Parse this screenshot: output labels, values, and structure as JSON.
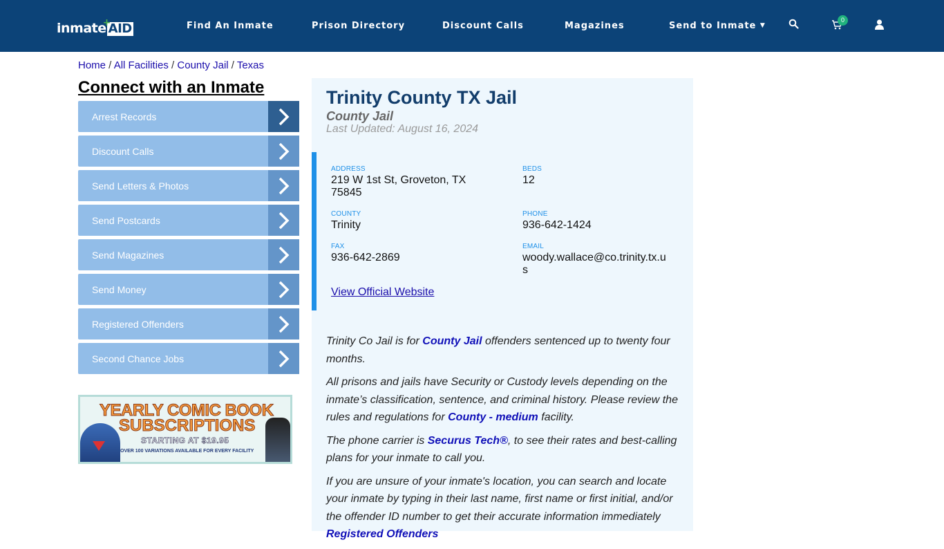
{
  "header": {
    "logo": {
      "text": "inmate",
      "accent": "AID"
    },
    "nav": [
      {
        "label": "Find An Inmate"
      },
      {
        "label": "Prison Directory"
      },
      {
        "label": "Discount Calls"
      },
      {
        "label": "Magazines"
      },
      {
        "label": "Send to Inmate",
        "has_dropdown": true
      }
    ],
    "icons": {
      "search": "search-icon",
      "cart": "cart-icon",
      "user": "user-icon"
    },
    "cart_count": "0",
    "colors": {
      "nav_bg": "#0c4378",
      "badge": "#20b27d"
    }
  },
  "breadcrumb": [
    {
      "label": "Home"
    },
    {
      "label": "All Facilities"
    },
    {
      "label": "County Jail"
    },
    {
      "label": "Texas"
    }
  ],
  "sidebar": {
    "heading": "Connect with an Inmate",
    "items": [
      {
        "label": "Arrest Records"
      },
      {
        "label": "Discount Calls"
      },
      {
        "label": "Send Letters & Photos"
      },
      {
        "label": "Send Postcards"
      },
      {
        "label": "Send Magazines"
      },
      {
        "label": "Send Money"
      },
      {
        "label": "Registered Offenders"
      },
      {
        "label": "Second Chance Jobs"
      }
    ],
    "banner": {
      "line1": "YEARLY COMIC BOOK",
      "line2": "SUBSCRIPTIONS",
      "line3": "STARTING AT $19.95",
      "line4": "OVER 100 VARIATIONS AVAILABLE FOR EVERY FACILITY"
    }
  },
  "facility": {
    "title": "Trinity County TX Jail",
    "type": "County Jail",
    "last_updated": "Last Updated: August 16, 2024",
    "fields": {
      "address": {
        "label": "ADDRESS",
        "value": "219 W 1st St, Groveton, TX 75845"
      },
      "beds": {
        "label": "BEDS",
        "value": "12"
      },
      "county": {
        "label": "COUNTY",
        "value": "Trinity"
      },
      "phone": {
        "label": "PHONE",
        "value": "936-642-1424"
      },
      "fax": {
        "label": "FAX",
        "value": "936-642-2869"
      },
      "email": {
        "label": "EMAIL",
        "value": "woody.wallace@co.trinity.tx.us"
      }
    },
    "website_link": "View Official Website"
  },
  "description": {
    "p1": {
      "a": "Trinity Co Jail is for ",
      "link": "County Jail",
      "b": " offenders sentenced up to twenty four months."
    },
    "p2": {
      "a": "All prisons and jails have Security or Custody levels depending on the inmate’s classification, sentence, and criminal history. Please review the rules and regulations for ",
      "link": "County - medium",
      "b": " facility."
    },
    "p3": {
      "a": "The phone carrier is ",
      "link": "Securus Tech®",
      "b": ", to see their rates and best-calling plans for your inmate to call you."
    },
    "p4": {
      "a": "If you are unsure of your inmate's location, you can search and locate your inmate by typing in their last name, first name or first initial, and/or the offender ID number to get their accurate information immediately ",
      "link": "Registered Offenders"
    }
  }
}
